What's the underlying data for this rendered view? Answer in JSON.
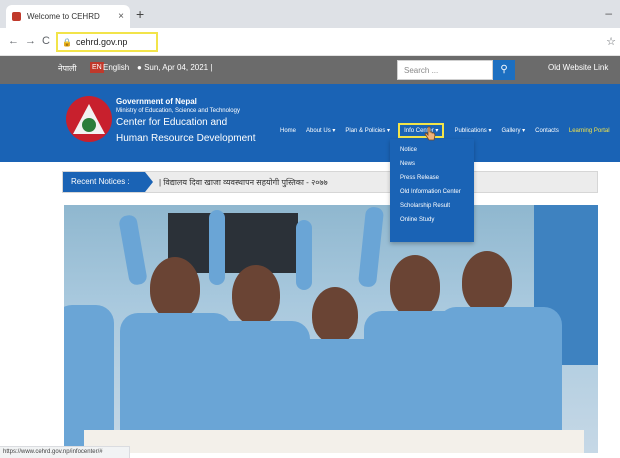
{
  "browser": {
    "tab_title": "Welcome to CEHRD",
    "tab_close": "×",
    "new_tab": "+",
    "back": "←",
    "forward": "→",
    "reload": "C",
    "url": "cehrd.gov.np",
    "minimize": "–",
    "status_url": "https://www.cehrd.gov.np/infocenter/#"
  },
  "topbar": {
    "lang_nepali": "नेपाली",
    "lang_en_badge": "EN",
    "lang_english": "English",
    "date": "Sun, Apr 04, 2021  |",
    "search_placeholder": "Search ...",
    "old_website": "Old Website Link"
  },
  "header": {
    "government": "Government of Nepal",
    "ministry": "Ministry of Education, Science and Technology",
    "center_line1": "Center for Education and",
    "center_line2": "Human Resource Development"
  },
  "menu": {
    "items": [
      "Home",
      "About Us ▾",
      "Plan & Policies ▾",
      "Info Center ▾",
      "Publications ▾",
      "Gallery ▾",
      "Contacts",
      "Learning Portal"
    ]
  },
  "dropdown": {
    "items": [
      "Notice",
      "News",
      "Press Release",
      "Old Information Center",
      "Scholarship Result",
      "Online Study"
    ]
  },
  "notice": {
    "label": "Recent Notices :",
    "text": "|  विद्यालय दिवा खाजा व्यवस्थापन सहयोगी पुस्तिका - २०७७"
  },
  "colors": {
    "header_blue": "#1a63b5",
    "highlight_yellow": "#f2e44a",
    "topbar_grey": "#6b6b6b"
  },
  "hero_image": "classroom students raising hands"
}
